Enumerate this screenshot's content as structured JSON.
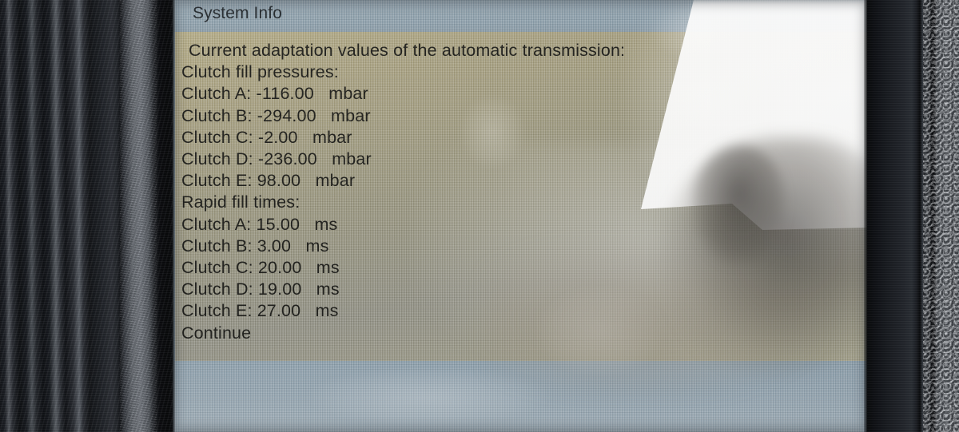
{
  "device": {
    "kind": "automotive-diagnostic-scanner",
    "bezel_color": "#1a1d22",
    "screen_background": "#93a5b1",
    "panel_color": "#a09a82",
    "text_color": "#1b1b18"
  },
  "header": {
    "title": "System Info"
  },
  "content": {
    "heading": "Current adaptation values of the automatic transmission:",
    "section_pressures_label": "Clutch fill pressures:",
    "pressures": [
      {
        "label": "Clutch A:",
        "value": "-116.00",
        "unit": "mbar",
        "text": "Clutch A: -116.00   mbar"
      },
      {
        "label": "Clutch B:",
        "value": "-294.00",
        "unit": "mbar",
        "text": "Clutch B: -294.00   mbar"
      },
      {
        "label": "Clutch C:",
        "value": "-2.00",
        "unit": "mbar",
        "text": "Clutch C: -2.00   mbar"
      },
      {
        "label": "Clutch D:",
        "value": "-236.00",
        "unit": "mbar",
        "text": "Clutch D: -236.00   mbar"
      },
      {
        "label": "Clutch E:",
        "value": "98.00",
        "unit": "mbar",
        "text": "Clutch E: 98.00   mbar"
      }
    ],
    "section_times_label": "Rapid fill times:",
    "times": [
      {
        "label": "Clutch A:",
        "value": "15.00",
        "unit": "ms",
        "text": "Clutch A: 15.00   ms"
      },
      {
        "label": "Clutch B:",
        "value": "3.00",
        "unit": "ms",
        "text": "Clutch B: 3.00   ms"
      },
      {
        "label": "Clutch C:",
        "value": "20.00",
        "unit": "ms",
        "text": "Clutch C: 20.00   ms"
      },
      {
        "label": "Clutch D:",
        "value": "19.00",
        "unit": "ms",
        "text": "Clutch D: 19.00   ms"
      },
      {
        "label": "Clutch E:",
        "value": "27.00",
        "unit": "ms",
        "text": "Clutch E: 27.00   ms"
      }
    ],
    "continue_label": "Continue"
  }
}
